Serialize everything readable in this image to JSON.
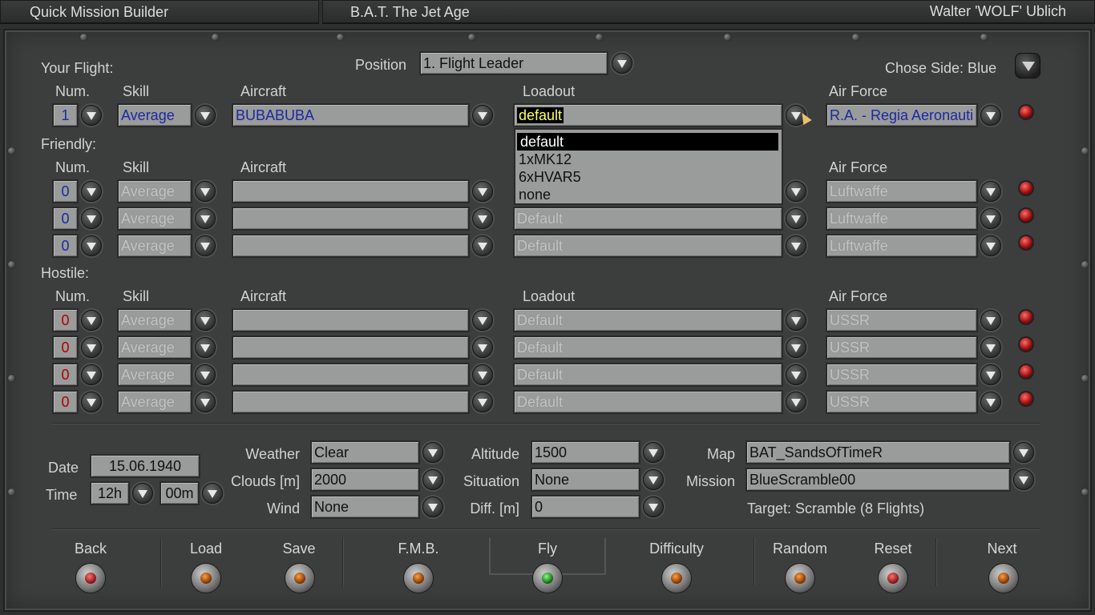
{
  "titlebar": {
    "left": "Quick Mission Builder",
    "middle": "B.A.T. The Jet Age",
    "right": "Walter 'WOLF' Ublich"
  },
  "your_flight": {
    "heading": "Your Flight:",
    "position_label": "Position",
    "position_value": "1. Flight Leader",
    "side_label": "Chose Side: Blue",
    "headers": {
      "num": "Num.",
      "skill": "Skill",
      "aircraft": "Aircraft",
      "loadout": "Loadout",
      "air_force": "Air Force"
    },
    "row": {
      "num": "1",
      "skill": "Average",
      "aircraft": "BUBABUBA",
      "loadout": "default",
      "air_force": "R.A. - Regia Aeronauti"
    },
    "loadout_options": [
      "default",
      "1xMK12",
      "6xHVAR5",
      "none"
    ]
  },
  "friendly": {
    "heading": "Friendly:",
    "headers": {
      "num": "Num.",
      "skill": "Skill",
      "aircraft": "Aircraft",
      "air_force": "Air Force"
    },
    "rows": [
      {
        "num": "0",
        "skill": "Average",
        "aircraft": "",
        "loadout": "",
        "air_force": "Luftwaffe"
      },
      {
        "num": "0",
        "skill": "Average",
        "aircraft": "",
        "loadout": "Default",
        "air_force": "Luftwaffe"
      },
      {
        "num": "0",
        "skill": "Average",
        "aircraft": "",
        "loadout": "Default",
        "air_force": "Luftwaffe"
      }
    ]
  },
  "hostile": {
    "heading": "Hostile:",
    "headers": {
      "num": "Num.",
      "skill": "Skill",
      "aircraft": "Aircraft",
      "loadout": "Loadout",
      "air_force": "Air Force"
    },
    "rows": [
      {
        "num": "0",
        "skill": "Average",
        "aircraft": "",
        "loadout": "Default",
        "air_force": "USSR"
      },
      {
        "num": "0",
        "skill": "Average",
        "aircraft": "",
        "loadout": "Default",
        "air_force": "USSR"
      },
      {
        "num": "0",
        "skill": "Average",
        "aircraft": "",
        "loadout": "Default",
        "air_force": "USSR"
      },
      {
        "num": "0",
        "skill": "Average",
        "aircraft": "",
        "loadout": "Default",
        "air_force": "USSR"
      }
    ]
  },
  "settings": {
    "date_label": "Date",
    "date_value": "15.06.1940",
    "time_label": "Time",
    "time_hour": "12h",
    "time_min": "00m",
    "weather_label": "Weather",
    "weather_value": "Clear",
    "clouds_label": "Clouds [m]",
    "clouds_value": "2000",
    "wind_label": "Wind",
    "wind_value": "None",
    "altitude_label": "Altitude",
    "altitude_value": "1500",
    "situation_label": "Situation",
    "situation_value": "None",
    "diff_label": "Diff. [m]",
    "diff_value": "0",
    "map_label": "Map",
    "map_value": "BAT_SandsOfTimeR",
    "mission_label": "Mission",
    "mission_value": "BlueScramble00",
    "target_text": "Target: Scramble (8 Flights)"
  },
  "buttons": {
    "back": "Back",
    "load": "Load",
    "save": "Save",
    "fmb": "F.M.B.",
    "fly": "Fly",
    "difficulty": "Difficulty",
    "random": "Random",
    "reset": "Reset",
    "next": "Next"
  },
  "colors": {
    "lamp_red": "#c02020",
    "lamp_amber": "#c06010",
    "lamp_green": "#30c030"
  }
}
